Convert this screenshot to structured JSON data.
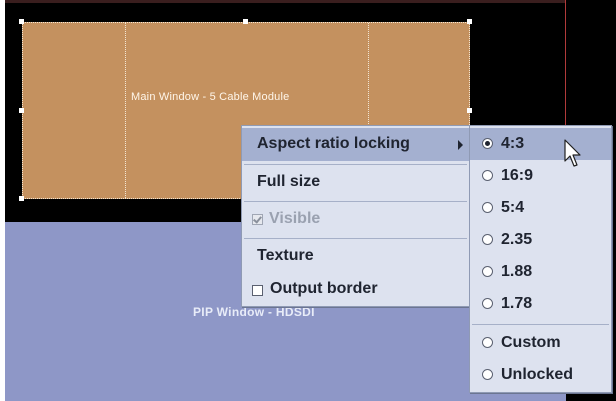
{
  "canvas": {
    "main_window": {
      "label": "Main Window - 5 Cable Module"
    },
    "pip_window": {
      "label": "PIP Window - HDSDI"
    }
  },
  "context_menu": {
    "items": [
      {
        "label": "Aspect ratio locking",
        "has_submenu": true,
        "highlighted": true
      },
      {
        "label": "Full size"
      },
      {
        "label": "Visible",
        "checkbox": true,
        "checked": true,
        "disabled": true
      },
      {
        "label": "Texture"
      },
      {
        "label": "Output border",
        "checkbox": true,
        "checked": false
      }
    ]
  },
  "aspect_submenu": {
    "selected": "4:3",
    "options": [
      {
        "label": "4:3",
        "checked": true,
        "highlighted": true
      },
      {
        "label": "16:9"
      },
      {
        "label": "5:4"
      },
      {
        "label": "2.35"
      },
      {
        "label": "1.88"
      },
      {
        "label": "1.78"
      },
      {
        "label": "Custom"
      },
      {
        "label": "Unlocked"
      }
    ]
  },
  "icons": {
    "cursor": "arrow-pointer-icon"
  },
  "colors": {
    "main_window": "#c4915f",
    "pip_window": "#8e97c7",
    "menu_background": "#dde2ef",
    "menu_highlight": "#a4b0d0"
  }
}
